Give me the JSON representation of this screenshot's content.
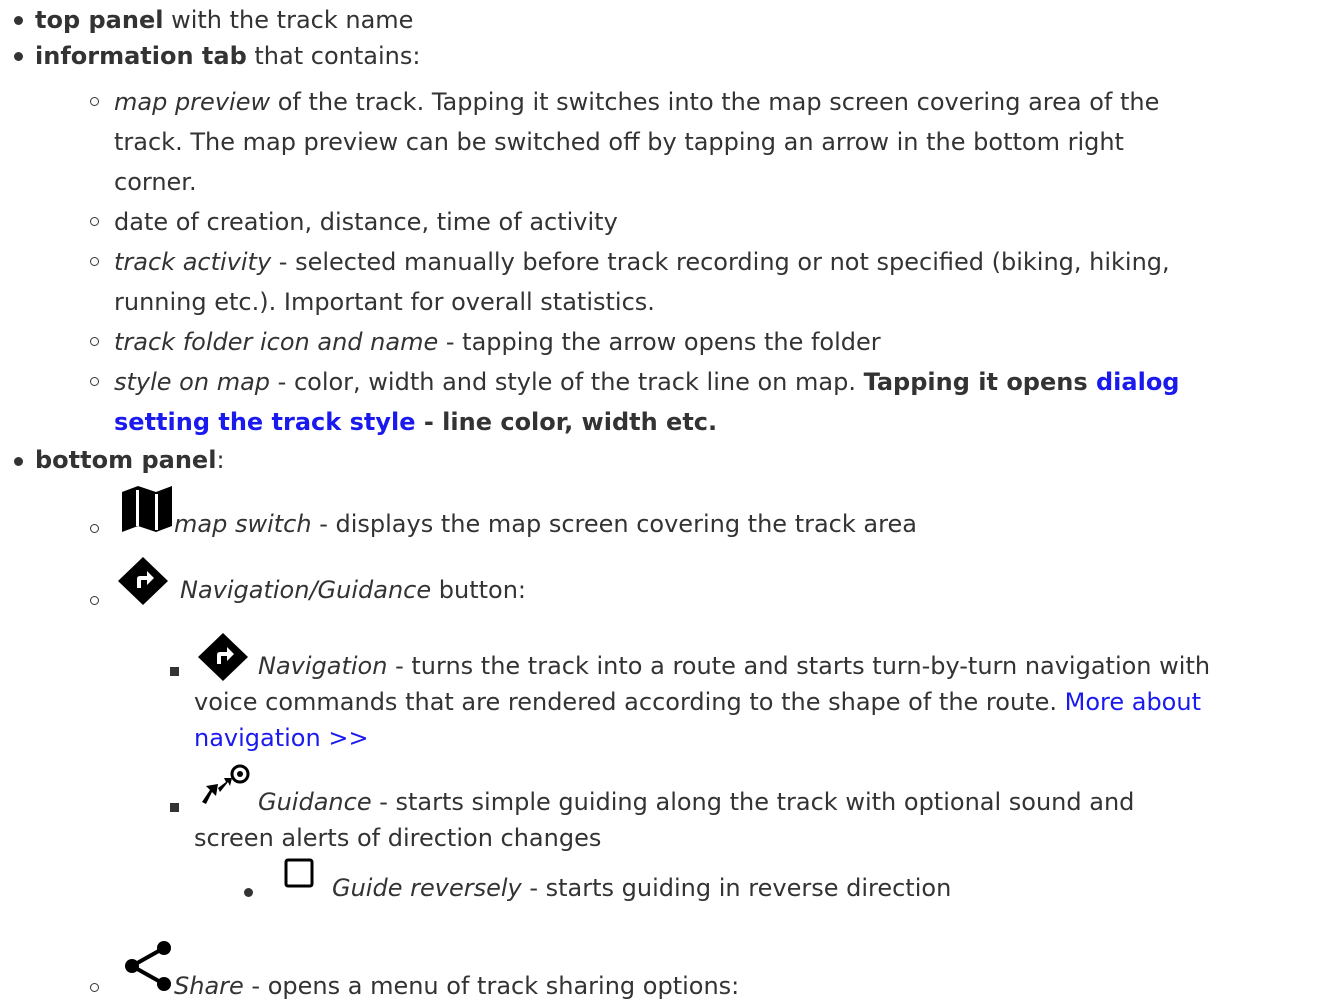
{
  "items": {
    "top_panel": {
      "term": "top panel",
      "rest": " with the track name"
    },
    "information_tab": {
      "term": "information tab",
      "rest": " that contains:"
    },
    "map_preview": {
      "term": "map preview",
      "rest_line1": " of the track. Tapping it switches into the map screen covering area of the",
      "line2": "track. The map preview can be switched off by tapping an arrow in the bottom right",
      "line3": "corner."
    },
    "date": {
      "text": "date of creation, distance, time of activity"
    },
    "track_activity": {
      "term": "track activity",
      "rest_line1": " - selected manually before track recording or not specified (biking, hiking,",
      "line2": "running etc.). Important for overall statistics."
    },
    "track_folder": {
      "term": "track folder icon and name",
      "rest": " - tapping the arrow opens the folder"
    },
    "style_on_map": {
      "term": "style on map",
      "rest_line1": " - color, width and style of the track line on map. ",
      "bold_line1": "Tapping it opens ",
      "link_line1": "dialog",
      "link_line2": "setting the track style",
      "bold_line2": " - line color, width etc."
    },
    "bottom_panel": {
      "term": "bottom panel",
      "rest": ":"
    },
    "map_switch": {
      "term": "map switch",
      "rest": " - displays the map screen covering the track area"
    },
    "nav_guidance": {
      "term": "Navigation/Guidance",
      "rest": " button:"
    },
    "navigation": {
      "term": "Navigation",
      "rest_line1": " - turns the track into a route and starts turn-by-turn navigation with",
      "line2": "voice commands that are rendered according to the shape of the route. ",
      "link_line2": "More about",
      "link_line3": "navigation >>"
    },
    "guidance": {
      "term": "Guidance",
      "rest_line1": " - starts simple guiding along the track with optional sound and",
      "line2": "screen alerts of direction changes"
    },
    "guide_reversely": {
      "term": "Guide reversely",
      "rest": " - starts guiding in reverse direction"
    },
    "share": {
      "term": "Share",
      "rest": " - opens a menu of track sharing options:"
    }
  },
  "icons": {
    "map": "map-icon",
    "navigation": "navigation-diamond-icon",
    "guidance": "guidance-icon",
    "checkbox": "checkbox-icon",
    "share": "share-icon"
  },
  "colors": {
    "text": "#333333",
    "link": "#1a1aee"
  }
}
